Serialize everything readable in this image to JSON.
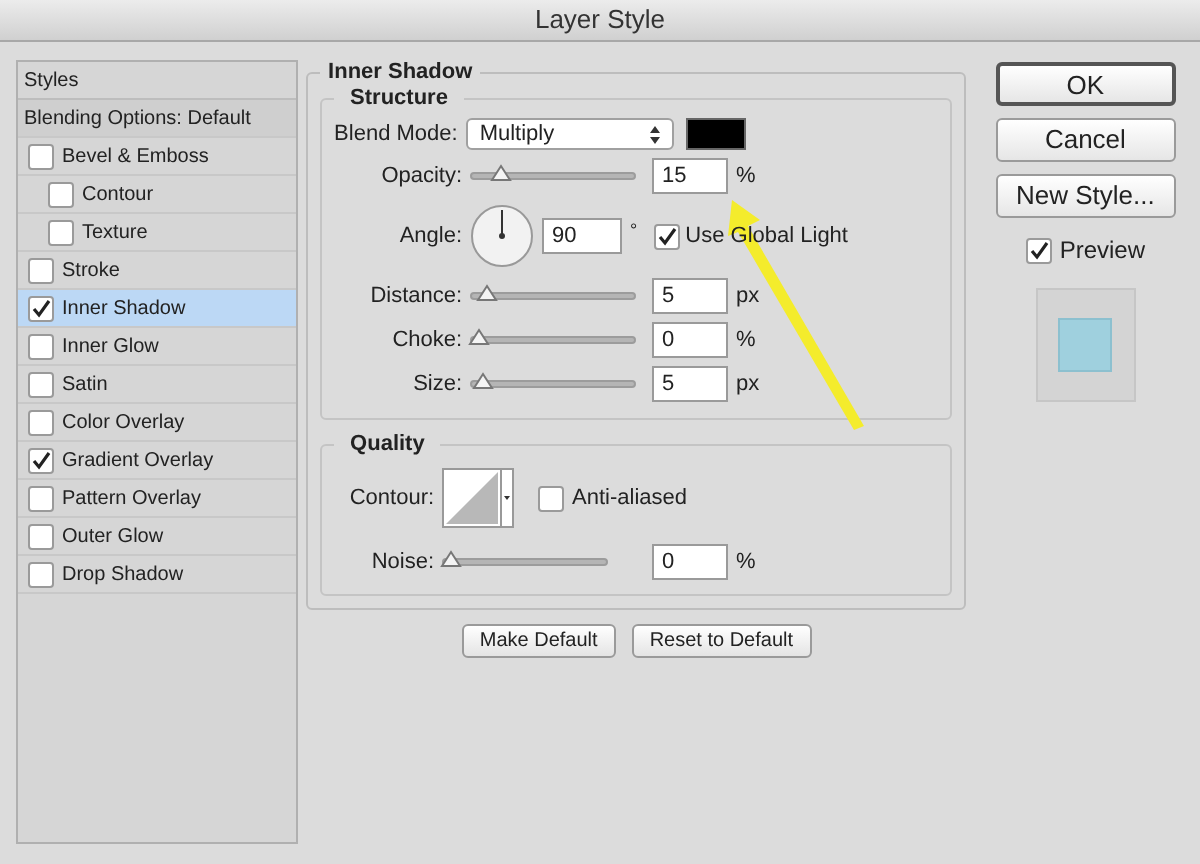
{
  "window": {
    "title": "Layer Style"
  },
  "styles_panel": {
    "header": "Styles",
    "items": [
      {
        "label": "Blending Options: Default",
        "kind": "heading",
        "selected": false
      },
      {
        "label": "Bevel & Emboss",
        "kind": "check",
        "checked": false,
        "selected": false,
        "children": [
          {
            "label": "Contour",
            "kind": "check",
            "checked": false,
            "selected": false
          },
          {
            "label": "Texture",
            "kind": "check",
            "checked": false,
            "selected": false
          }
        ]
      },
      {
        "label": "Stroke",
        "kind": "check",
        "checked": false,
        "selected": false
      },
      {
        "label": "Inner Shadow",
        "kind": "check",
        "checked": true,
        "selected": true
      },
      {
        "label": "Inner Glow",
        "kind": "check",
        "checked": false,
        "selected": false
      },
      {
        "label": "Satin",
        "kind": "check",
        "checked": false,
        "selected": false
      },
      {
        "label": "Color Overlay",
        "kind": "check",
        "checked": false,
        "selected": false
      },
      {
        "label": "Gradient Overlay",
        "kind": "check",
        "checked": true,
        "selected": false
      },
      {
        "label": "Pattern Overlay",
        "kind": "check",
        "checked": false,
        "selected": false
      },
      {
        "label": "Outer Glow",
        "kind": "check",
        "checked": false,
        "selected": false
      },
      {
        "label": "Drop Shadow",
        "kind": "check",
        "checked": false,
        "selected": false
      }
    ]
  },
  "section": {
    "title": "Inner Shadow",
    "structure": {
      "title": "Structure",
      "blend_mode": {
        "label": "Blend Mode:",
        "value": "Multiply"
      },
      "rows": [
        {
          "kind": "slider",
          "label": "Opacity:",
          "level": 0.15,
          "value": "15",
          "unit": "%"
        },
        {
          "kind": "angle",
          "label": "Angle:",
          "value": "90",
          "unit": "°",
          "global_light": {
            "label": "Use Global Light",
            "checked": true
          }
        },
        {
          "kind": "slider",
          "label": "Distance:",
          "level": 0.05,
          "value": "5",
          "unit": "px"
        },
        {
          "kind": "slider",
          "label": "Choke:",
          "level": 0,
          "value": "0",
          "unit": "%"
        },
        {
          "kind": "slider",
          "label": "Size:",
          "level": 0.03,
          "value": "5",
          "unit": "px"
        }
      ]
    },
    "quality": {
      "title": "Quality",
      "contour_label": "Contour:",
      "anti_aliased": {
        "label": "Anti-aliased",
        "checked": false
      },
      "noise": {
        "label": "Noise:",
        "level": 0,
        "value": "0",
        "unit": "%"
      }
    },
    "buttons": [
      "Make Default",
      "Reset to Default"
    ]
  },
  "right_buttons": [
    "OK",
    "Cancel",
    "New Style..."
  ],
  "preview": {
    "label": "Preview",
    "checked": true
  }
}
